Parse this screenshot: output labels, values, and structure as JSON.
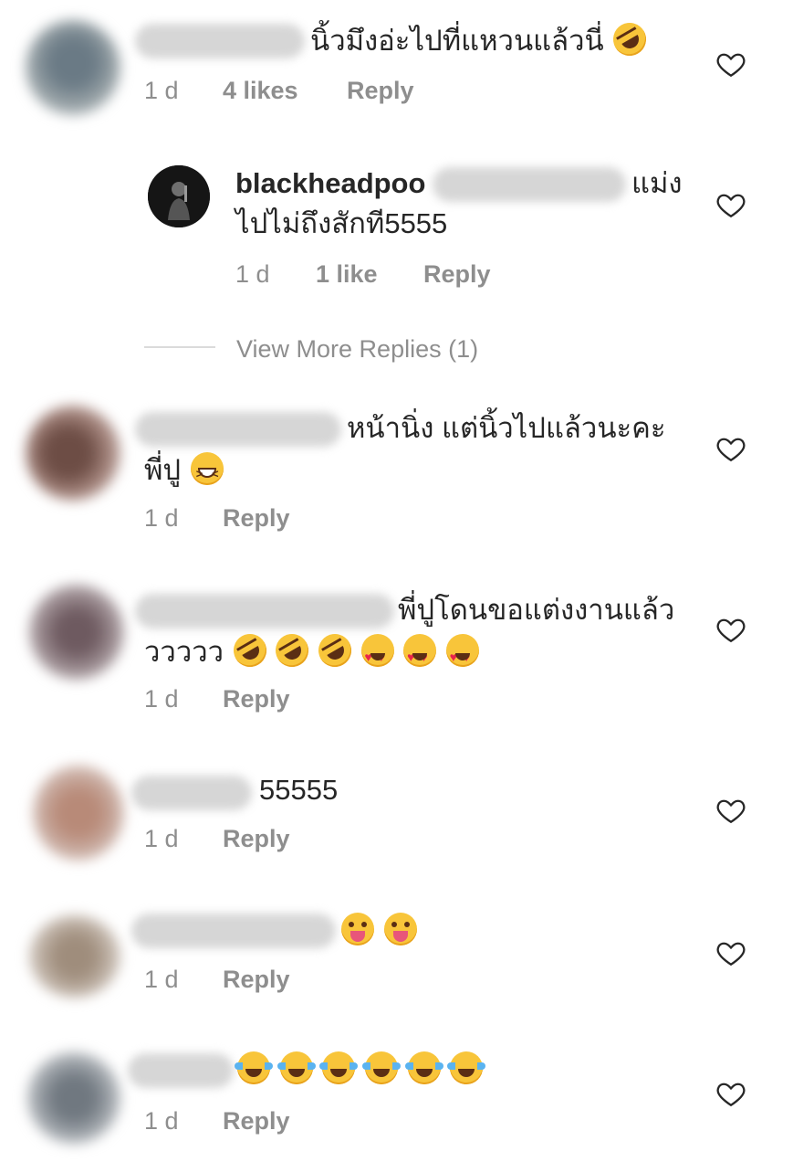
{
  "heart_icon": "heart-outline-icon",
  "comments": [
    {
      "text": "นิ้วมึงอ่ะไปที่แหวนแล้วนี่",
      "emojis": [
        "rofl"
      ],
      "time": "1 d",
      "likes": "4 likes",
      "reply": "Reply"
    },
    {
      "username": "blackheadpoo",
      "text_line1_tail": "แม่ง",
      "text_line2": "ไปไม่ถึงสักที5555",
      "time": "1 d",
      "likes": "1 like",
      "reply": "Reply"
    },
    {
      "view_more": "View More Replies (1)"
    },
    {
      "text_line1": "หน้านิ่ง แต่นิ้วไปแล้วนะคะ",
      "text_line2": "พี่ปู",
      "emojis": [
        "grin"
      ],
      "time": "1 d",
      "reply": "Reply"
    },
    {
      "text_line1": "พี่ปูโดนขอแต่งงานแล้ว",
      "text_line2": "ววววว",
      "emojis": [
        "rofl",
        "rofl",
        "rofl",
        "hearteyes",
        "hearteyes",
        "hearteyes"
      ],
      "time": "1 d",
      "reply": "Reply"
    },
    {
      "text": "55555",
      "time": "1 d",
      "reply": "Reply"
    },
    {
      "emojis": [
        "wink",
        "wink"
      ],
      "time": "1 d",
      "reply": "Reply"
    },
    {
      "emojis": [
        "laughcry",
        "laughcry",
        "laughcry",
        "laughcry",
        "laughcry",
        "laughcry"
      ],
      "time": "1 d",
      "reply": "Reply"
    }
  ]
}
